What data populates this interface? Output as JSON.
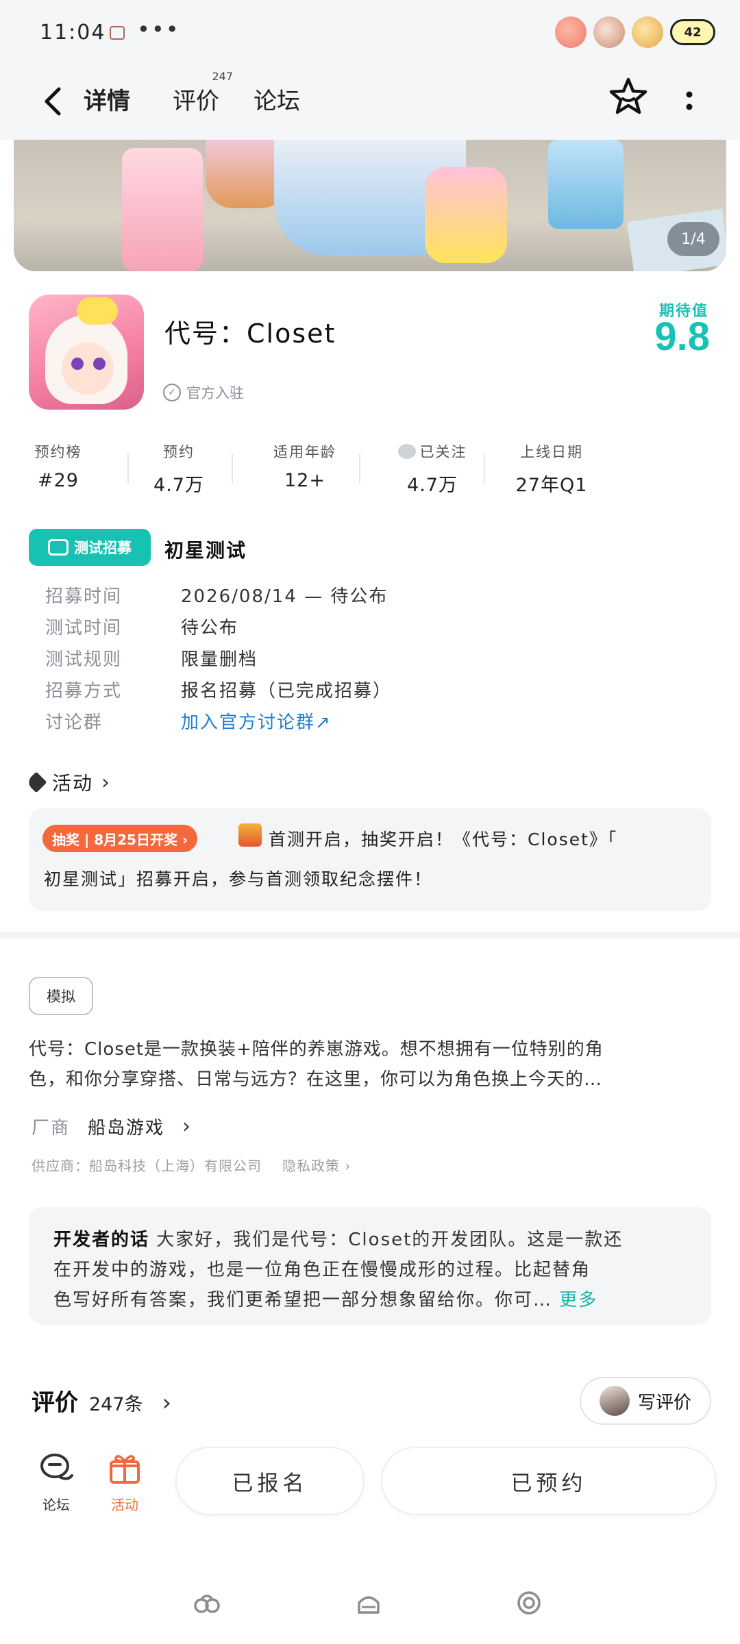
{
  "status_bar": {
    "time": "11:04",
    "dots": "•••",
    "battery": "42"
  },
  "nav": {
    "tabs": [
      {
        "label": "详情",
        "active": true
      },
      {
        "label": "评价",
        "count": "247"
      },
      {
        "label": "论坛"
      }
    ],
    "accent_color": "#17c8b8"
  },
  "banner": {
    "indicator": "1/4"
  },
  "game": {
    "title": "代号：Closet",
    "official_label": "官方入驻",
    "expect_label": "期待值",
    "expect_score": "9.8"
  },
  "stats": [
    {
      "label": "预约榜",
      "value": "#29"
    },
    {
      "label": "预约",
      "value": "4.7万"
    },
    {
      "label": "适用年龄",
      "value": "12+"
    },
    {
      "label": "已关注",
      "value": "4.7万"
    },
    {
      "label": "上线日期",
      "value": "27年Q1"
    }
  ],
  "test": {
    "badge": "测试招募",
    "title": "初星测试",
    "rows": [
      {
        "key": "招募时间",
        "value": "2026/08/14 — 待公布"
      },
      {
        "key": "测试时间",
        "value": "待公布"
      },
      {
        "key": "测试规则",
        "value": "限量删档"
      },
      {
        "key": "招募方式",
        "value": "报名招募（已完成招募）"
      },
      {
        "key": "讨论群",
        "value": "加入官方讨论群↗"
      }
    ]
  },
  "activity": {
    "heading": "活动",
    "tag": "抽奖 | 8月25日开奖 ›",
    "text_line1": "首测开启，抽奖开启！《代号：Closet》「",
    "text_line2": "初星测试」招募开启，参与首测领取纪念摆件！"
  },
  "description": {
    "tag": "模拟",
    "line1": "代号：Closet是一款换装+陪伴的养崽游戏。想不想拥有一位特别的角",
    "line2": "色，和你分享穿搭、日常与远方？在这里，你可以为角色换上今天的…",
    "vendor_key": "厂商",
    "vendor_value": "船岛游戏",
    "supplier": "供应商：船岛科技（上海）有限公司",
    "privacy": "隐私政策 ›"
  },
  "developer_note": {
    "lead": "开发者的话",
    "line1": "大家好，我们是代号：Closet的开发团队。这是一款还",
    "line2": "在开发中的游戏，也是一位角色正在慢慢成形的过程。比起替角",
    "line3": "色写好所有答案，我们更希望把一部分想象留给你。你可…",
    "more": "更多"
  },
  "reviews": {
    "title": "评价",
    "count": "247条",
    "write_label": "写评价"
  },
  "bottom_bar": {
    "forum_label": "论坛",
    "activity_label": "活动",
    "signed_label": "已报名",
    "reserved_label": "已预约"
  }
}
